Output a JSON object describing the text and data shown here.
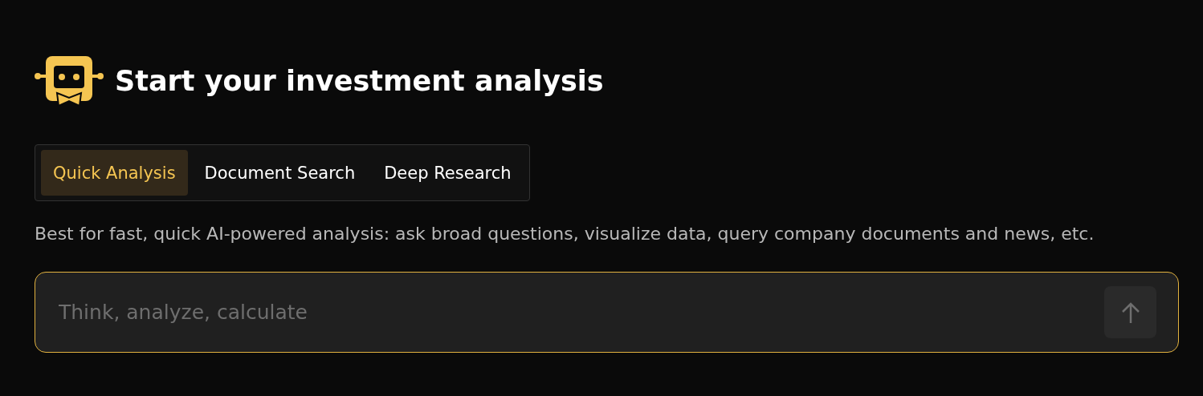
{
  "title": "Start your investment analysis",
  "tabs": [
    {
      "label": "Quick Analysis",
      "selected": true
    },
    {
      "label": "Document Search",
      "selected": false
    },
    {
      "label": "Deep Research",
      "selected": false
    }
  ],
  "description": "Best for fast, quick AI-powered analysis: ask broad questions, visualize data, query company documents and news, etc.",
  "input": {
    "placeholder": "Think, analyze, calculate"
  }
}
